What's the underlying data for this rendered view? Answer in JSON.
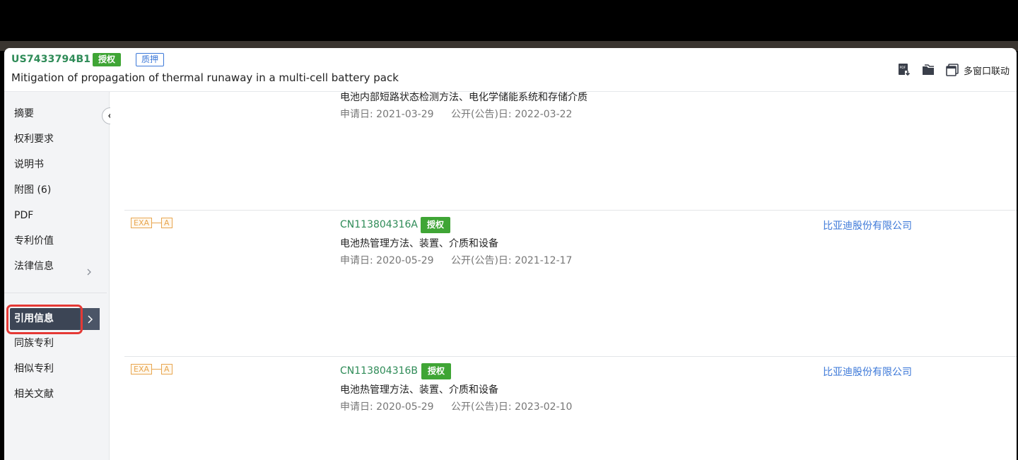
{
  "header": {
    "patent_id": "US7433794B1",
    "status_tag": "授权",
    "pledge_tag": "质押",
    "title": "Mitigation of propagation of thermal runaway in a multi-cell battery pack",
    "tools": {
      "pdf_download_icon": "pdf-download-icon",
      "folder_icon": "folder-icon",
      "multi_window_label": "多窗口联动"
    }
  },
  "sidebar": {
    "items": [
      {
        "label": "摘要"
      },
      {
        "label": "权利要求"
      },
      {
        "label": "说明书"
      },
      {
        "label": "附图 (6)"
      },
      {
        "label": "PDF"
      },
      {
        "label": "专利价值"
      },
      {
        "label": "法律信息"
      }
    ],
    "active": {
      "label": "引用信息"
    },
    "items_after": [
      {
        "label": "同族专利"
      },
      {
        "label": "相似专利"
      },
      {
        "label": "相关文献"
      }
    ]
  },
  "citations": [
    {
      "title": "电池内部短路状态检测方法、电化学储能系统和存储介质",
      "app_date": "申请日: 2021-03-29",
      "pub_date": "公开(公告)日: 2022-03-22"
    },
    {
      "badge_left": "EXA",
      "badge_right": "A",
      "pub_no": "CN113804316A",
      "tag": "授权",
      "title": "电池热管理方法、装置、介质和设备",
      "app_date": "申请日: 2020-05-29",
      "pub_date": "公开(公告)日: 2021-12-17",
      "applicant": "比亚迪股份有限公司"
    },
    {
      "badge_left": "EXA",
      "badge_right": "A",
      "pub_no": "CN113804316B",
      "tag": "授权",
      "title": "电池热管理方法、装置、介质和设备",
      "app_date": "申请日: 2020-05-29",
      "pub_date": "公开(公告)日: 2023-02-10",
      "applicant": "比亚迪股份有限公司"
    }
  ],
  "colors": {
    "accent_green": "#2e8b57",
    "tag_green": "#3fa535",
    "link_blue": "#3c78d8",
    "active_nav": "#3c4555",
    "highlight_red": "#e53935"
  }
}
